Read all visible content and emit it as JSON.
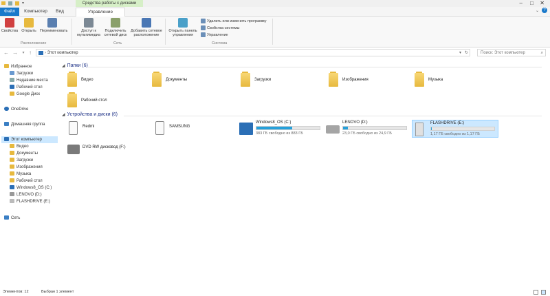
{
  "window": {
    "context_title": "Средства работы с дисками"
  },
  "ribbon": {
    "tabs": {
      "file": "Файл",
      "computer": "Компьютер",
      "view": "Вид",
      "manage": "Управление"
    },
    "groups": {
      "location": "Расположение",
      "network": "Сеть",
      "system": "Система"
    },
    "buttons": {
      "properties": "Свойства",
      "open": "Открыть",
      "rename": "Переименовать",
      "media_access": "Доступ к мультимедиа",
      "map_drive": "Подключить сетевой диск",
      "add_location": "Добавить сетевое расположение",
      "control_panel": "Открыть панель управления"
    },
    "small_buttons": {
      "uninstall": "Удалить или изменить программу",
      "sys_props": "Свойства системы",
      "manage": "Управление"
    }
  },
  "address": {
    "path": "Этот компьютер",
    "search_placeholder": "Поиск: Этот компьютер"
  },
  "nav": {
    "favorites": "Избранное",
    "fav_items": [
      "Загрузки",
      "Недавние места",
      "Рабочий стол",
      "Google Диск"
    ],
    "onedrive": "OneDrive",
    "homegroup": "Домашняя группа",
    "this_pc": "Этот компьютер",
    "pc_items": [
      "Видео",
      "Документы",
      "Загрузки",
      "Изображения",
      "Музыка",
      "Рабочий стол",
      "Windows8_OS (C:)",
      "LENOVO (D:)",
      "FLASHDRIVE (E:)"
    ],
    "network": "Сеть"
  },
  "main": {
    "folders_header": "Папки (6)",
    "folders": [
      "Видео",
      "Документы",
      "Загрузки",
      "Изображения",
      "Музыка",
      "Рабочий стол"
    ],
    "devices_header": "Устройства и диски (6)",
    "devices": [
      "Redmi",
      "SAMSUNG"
    ],
    "drives": [
      {
        "name": "Windows8_OS (C:)",
        "free": "383 ГБ свободно из 883 ГБ",
        "used_fraction": 0.57
      },
      {
        "name": "LENOVO (D:)",
        "free": "23,0 ГБ свободно из 24,9 ГБ",
        "used_fraction": 0.08
      },
      {
        "name": "FLASHDRIVE (E:)",
        "free": "1,17 ГБ свободно из 1,17 ГБ",
        "used_fraction": 0.01
      }
    ],
    "dvd": "DVD RW дисковод (F:)"
  },
  "status": {
    "count": "Элементов: 12",
    "selected": "Выбран 1 элемент"
  },
  "colors": {
    "accent": "#1979ca",
    "selection": "#cce8ff",
    "progress": "#26a0da",
    "folder": "#e7b93e"
  }
}
